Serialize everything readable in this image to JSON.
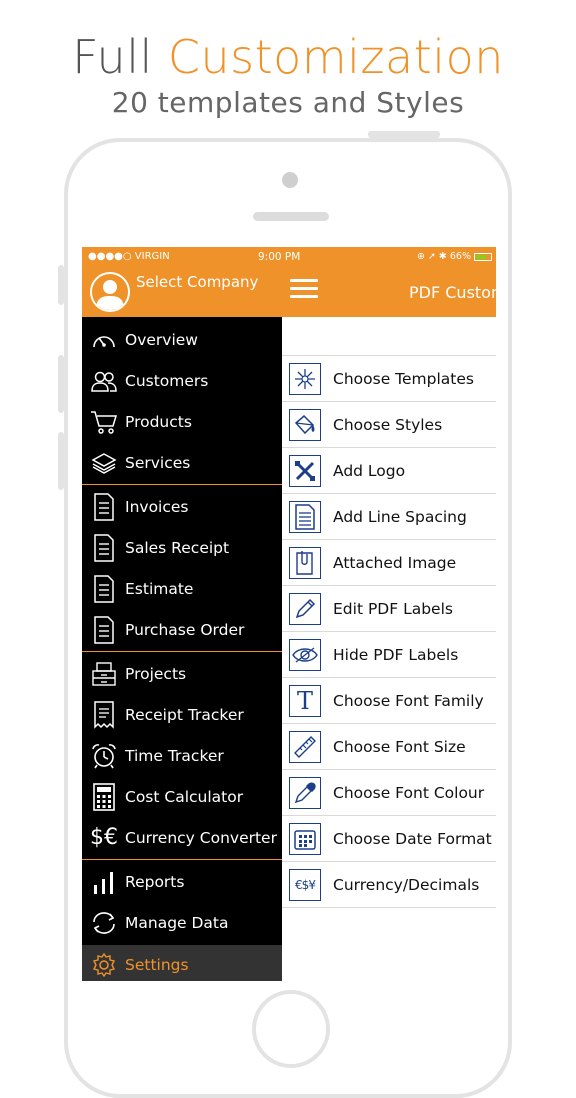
{
  "promo": {
    "headline_part1": "Full",
    "headline_part2": "Customization",
    "subline": "20 templates and Styles"
  },
  "status": {
    "carrier": "●●●●○ VIRGIN",
    "time": "9:00 PM",
    "battery": "66%"
  },
  "drawer": {
    "company": "Select Company",
    "items": [
      {
        "label": "Overview",
        "icon": "dashboard-icon"
      },
      {
        "label": "Customers",
        "icon": "people-icon"
      },
      {
        "label": "Products",
        "icon": "cart-icon"
      },
      {
        "label": "Services",
        "icon": "layers-icon"
      },
      {
        "label": "Invoices",
        "icon": "document-icon"
      },
      {
        "label": "Sales Receipt",
        "icon": "document-icon"
      },
      {
        "label": "Estimate",
        "icon": "document-icon"
      },
      {
        "label": "Purchase Order",
        "icon": "document-icon"
      },
      {
        "label": "Projects",
        "icon": "cabinet-icon"
      },
      {
        "label": "Receipt Tracker",
        "icon": "receipt-icon"
      },
      {
        "label": "Time Tracker",
        "icon": "alarm-clock-icon"
      },
      {
        "label": "Cost Calculator",
        "icon": "calculator-icon"
      },
      {
        "label": "Currency Converter",
        "icon": "currency-icon",
        "icon_text": "$€"
      },
      {
        "label": "Reports",
        "icon": "bar-chart-icon"
      },
      {
        "label": "Manage Data",
        "icon": "sync-icon"
      },
      {
        "label": "Settings",
        "icon": "gear-icon"
      }
    ]
  },
  "content": {
    "title": "PDF Customization",
    "rows": [
      {
        "label": "Choose Templates",
        "icon": "sparkle-icon"
      },
      {
        "label": "Choose Styles",
        "icon": "paint-bucket-icon"
      },
      {
        "label": "Add Logo",
        "icon": "tools-icon"
      },
      {
        "label": "Add Line Spacing",
        "icon": "lines-document-icon"
      },
      {
        "label": "Attached Image",
        "icon": "paperclip-icon"
      },
      {
        "label": "Edit PDF Labels",
        "icon": "pencil-icon"
      },
      {
        "label": "Hide PDF Labels",
        "icon": "eye-icon"
      },
      {
        "label": "Choose Font Family",
        "icon": "font-icon",
        "icon_text": "T"
      },
      {
        "label": "Choose Font Size",
        "icon": "ruler-icon"
      },
      {
        "label": "Choose Font Colour",
        "icon": "eyedropper-icon"
      },
      {
        "label": "Choose Date Format",
        "icon": "calendar-icon"
      },
      {
        "label": "Currency/Decimals",
        "icon": "currency-symbols-icon",
        "icon_text": "€$¥"
      }
    ]
  },
  "colors": {
    "accent": "#f0922a",
    "drawer_bg": "#000000",
    "icon_blue": "#1d3f8a"
  }
}
